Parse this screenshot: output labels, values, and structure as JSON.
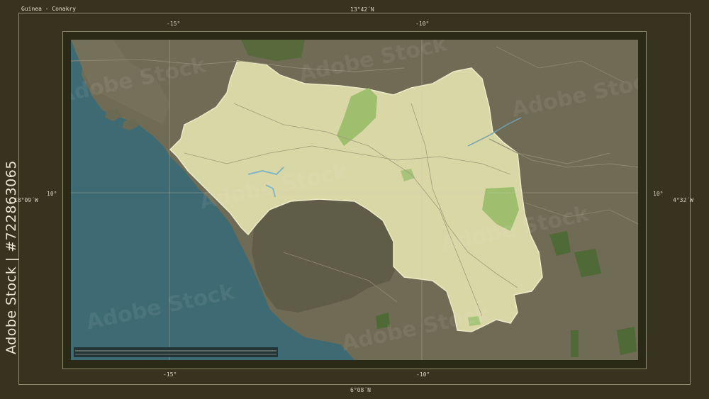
{
  "title": "Guinea - Conakry",
  "coords": {
    "top": "13°42´N",
    "bottom": "6°08´N",
    "left": "18°09´W",
    "right": "4°32´W"
  },
  "grid_labels": {
    "top_left": "-15°",
    "top_right": "-10°",
    "bottom_left": "-15°",
    "bottom_right": "-10°",
    "left": "10°",
    "right": "10°"
  },
  "watermark": "Adobe Stock | #722863065",
  "watermark_overlay": "Adobe Stock",
  "colors": {
    "ocean": "#3e6a73",
    "neighbor": "#6f6b55",
    "country": "#d9d7a6",
    "forest": "#9fbf6e",
    "grid": "#c9c6b2"
  }
}
